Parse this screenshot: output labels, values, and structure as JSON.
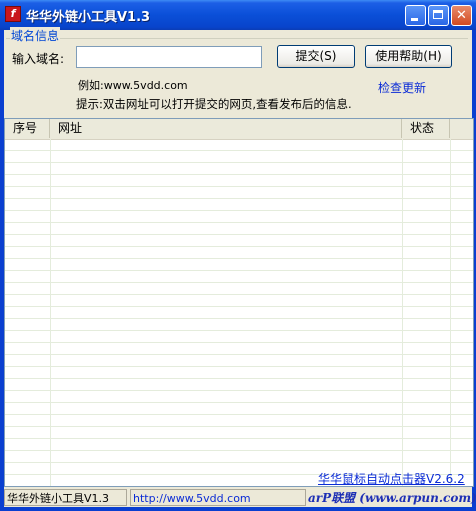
{
  "window": {
    "title": "华华外链小工具V1.3",
    "app_icon": "flash-icon"
  },
  "group": {
    "title": "域名信息"
  },
  "form": {
    "domain_label": "输入域名:",
    "domain_value": "",
    "submit_label": "提交(S)",
    "help_label": "使用帮助(H)",
    "example": "例如:www.5vdd.com",
    "check_update": "检查更新",
    "hint": "提示:双击网址可以打开提交的网页,查看发布后的信息."
  },
  "table": {
    "columns": [
      "序号",
      "网址",
      "状态"
    ],
    "rows": []
  },
  "footer": {
    "author_link": "华华鼠标自动点击器V2.6.2"
  },
  "statusbar": {
    "app": "华华外链小工具V1.3",
    "url": "http://www.5vdd.com",
    "logo": "arP联盟 (www.arpun.com)"
  }
}
